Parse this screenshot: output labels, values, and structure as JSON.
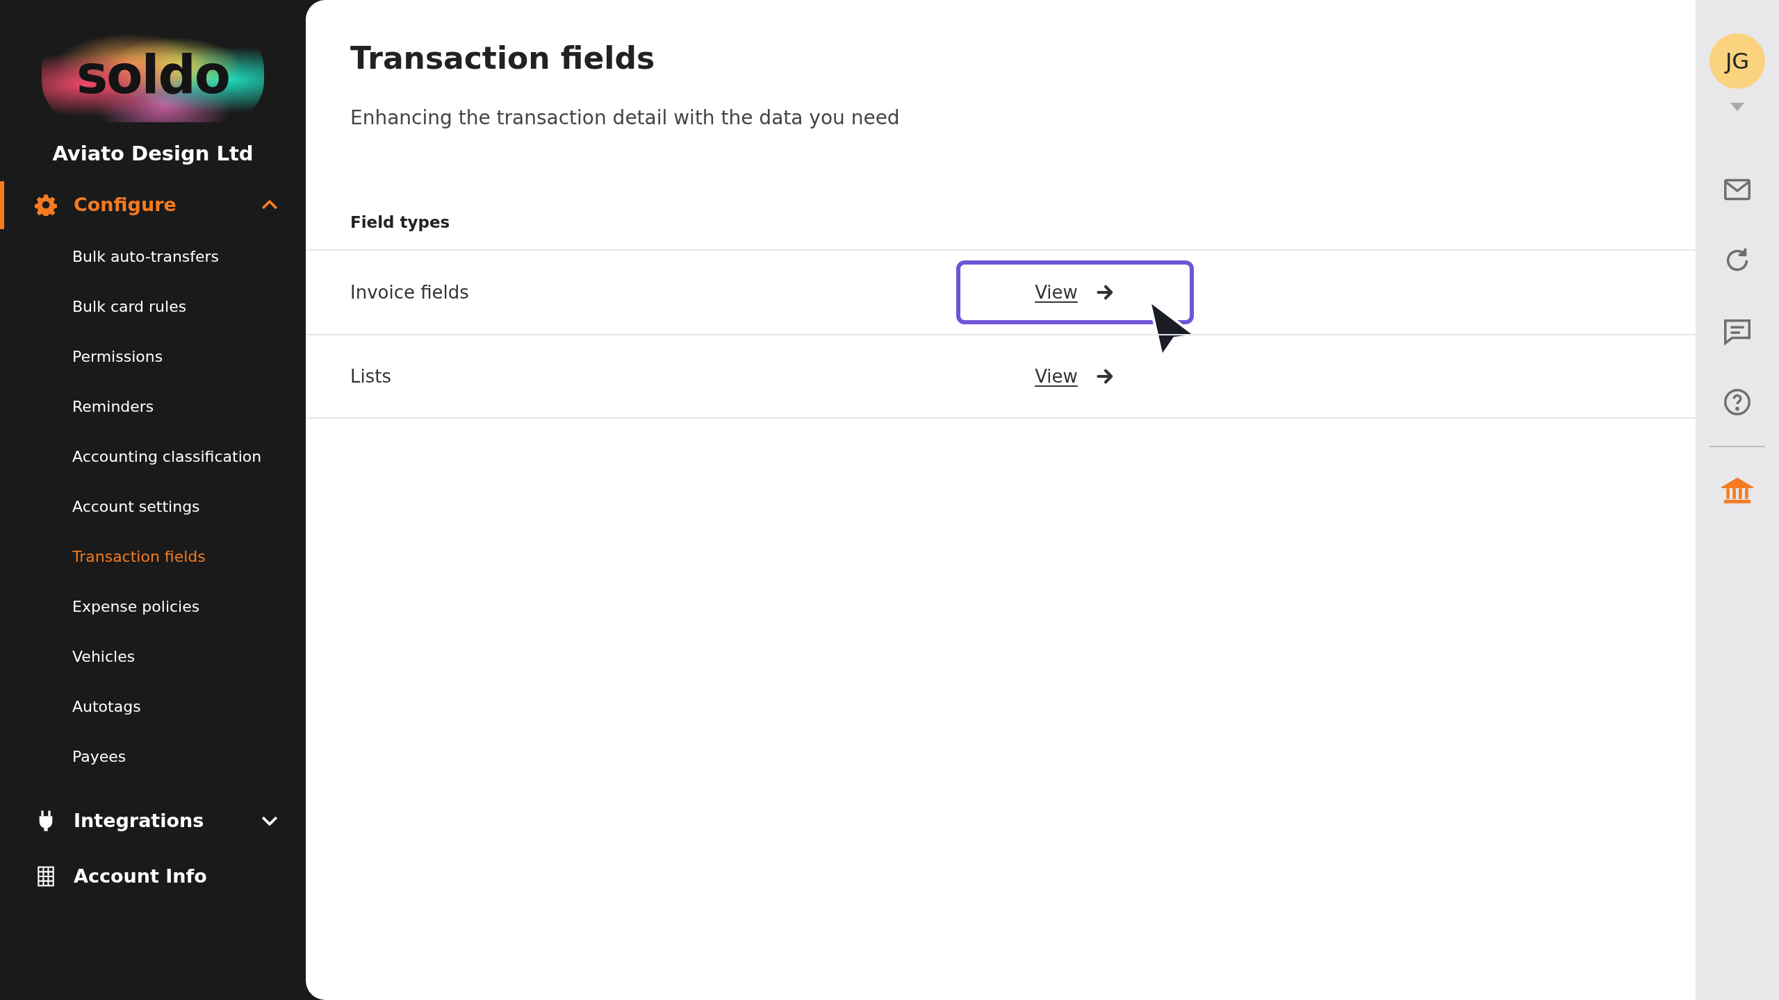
{
  "sidebar": {
    "logo": "soldo",
    "company": "Aviato Design Ltd",
    "sections": [
      {
        "label": "Configure",
        "expanded": true,
        "selected": true,
        "children": [
          {
            "label": "Bulk auto-transfers",
            "selected": false
          },
          {
            "label": "Bulk card rules",
            "selected": false
          },
          {
            "label": "Permissions",
            "selected": false
          },
          {
            "label": "Reminders",
            "selected": false
          },
          {
            "label": "Accounting classification",
            "selected": false
          },
          {
            "label": "Account settings",
            "selected": false
          },
          {
            "label": "Transaction fields",
            "selected": true
          },
          {
            "label": "Expense policies",
            "selected": false
          },
          {
            "label": "Vehicles",
            "selected": false
          },
          {
            "label": "Autotags",
            "selected": false
          },
          {
            "label": "Payees",
            "selected": false
          }
        ]
      },
      {
        "label": "Integrations",
        "expanded": false,
        "selected": false
      },
      {
        "label": "Account Info",
        "selected": false
      }
    ]
  },
  "page": {
    "title": "Transaction fields",
    "subtitle": "Enhancing the transaction detail with the data you need"
  },
  "table": {
    "header": "Field types",
    "rows": [
      {
        "label": "Invoice fields",
        "action": "View",
        "focused": true
      },
      {
        "label": "Lists",
        "action": "View",
        "focused": false
      }
    ]
  },
  "rail": {
    "avatar": "JG",
    "buttons": [
      {
        "selected": false
      },
      {
        "selected": false
      },
      {
        "selected": false
      },
      {
        "selected": false
      },
      {
        "selected": true
      }
    ]
  }
}
